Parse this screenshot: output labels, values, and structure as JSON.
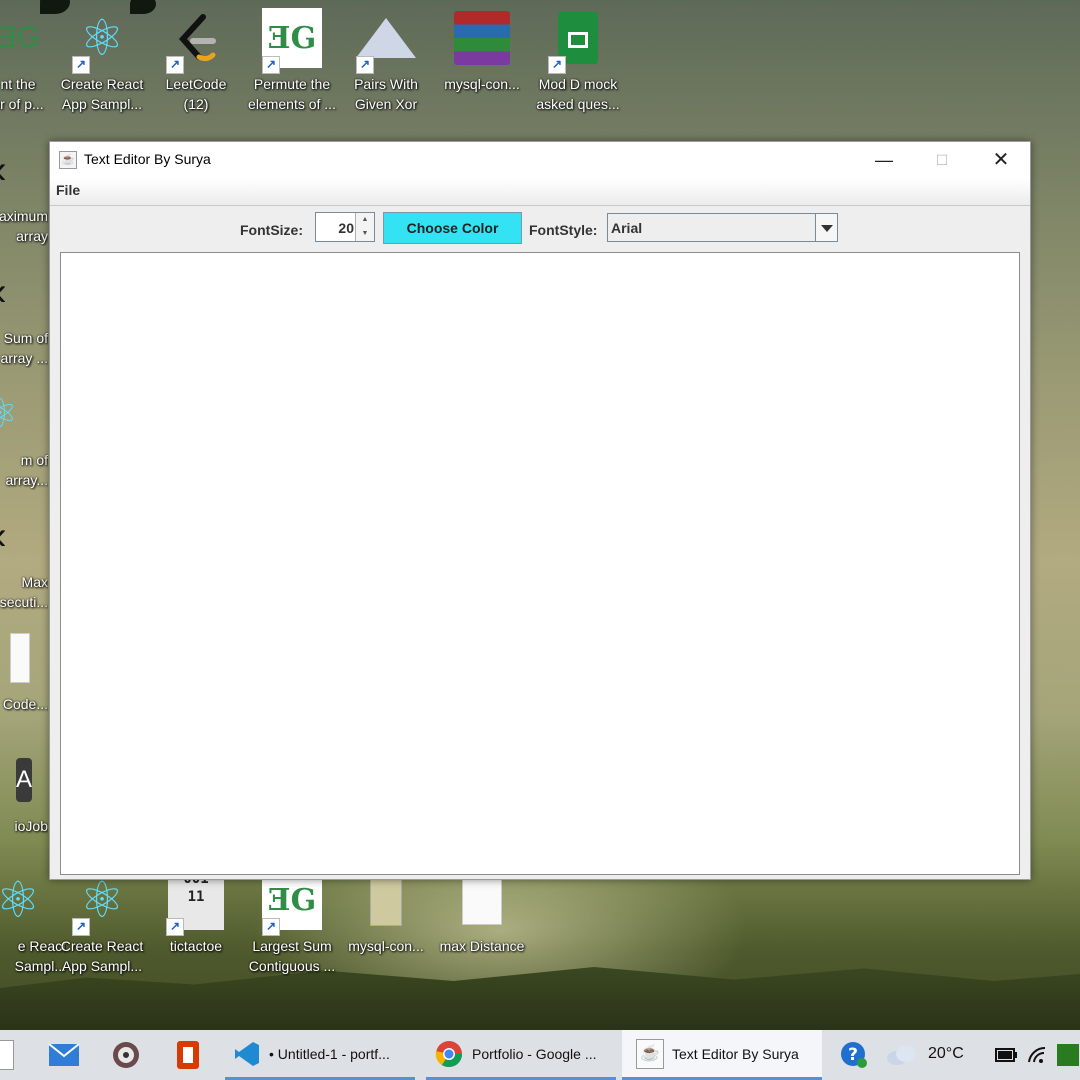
{
  "desktop": {
    "top_icons": [
      {
        "label1": "nt the",
        "label2": "er of p..."
      },
      {
        "label1": "Create React",
        "label2": "App Sampl..."
      },
      {
        "label1": "LeetCode",
        "label2": "(12)"
      },
      {
        "label1": "Permute the",
        "label2": "elements of ..."
      },
      {
        "label1": "Pairs With",
        "label2": "Given Xor"
      },
      {
        "label1": "mysql-con...",
        "label2": ""
      },
      {
        "label1": "Mod D mock",
        "label2": "asked ques..."
      }
    ],
    "left_icons": [
      {
        "label1": "aximum",
        "label2": "array"
      },
      {
        "label1": "Sum of",
        "label2": "array ..."
      },
      {
        "label1": "m of",
        "label2": "array..."
      },
      {
        "label1": "Max",
        "label2": "secuti..."
      },
      {
        "label1": "Code...",
        "label2": ""
      },
      {
        "label1": "ioJob",
        "label2": ""
      }
    ],
    "bottom_icons": [
      {
        "label1": "e React",
        "label2": "Sampl..."
      },
      {
        "label1": "Create React",
        "label2": "App Sampl..."
      },
      {
        "label1": "tictactoe",
        "label2": ""
      },
      {
        "label1": "Largest Sum",
        "label2": "Contiguous ..."
      },
      {
        "label1": "mysql-con...",
        "label2": ""
      },
      {
        "label1": "max Distance",
        "label2": ""
      }
    ],
    "gfg_glyph": "ƎG",
    "tictactoe_glyph": "001\n11"
  },
  "window": {
    "title": "Text Editor By Surya",
    "menu": {
      "file": "File"
    },
    "toolbar": {
      "font_size_label": "FontSize:",
      "font_size_value": "20",
      "choose_color_label": "Choose Color",
      "font_style_label": "FontStyle:",
      "font_style_value": "Arial"
    },
    "colors": {
      "choose_color_bg": "#33e3f3",
      "window_bg": "#eeeeee"
    }
  },
  "taskbar": {
    "tasks": [
      {
        "label": "• Untitled-1 - portf..."
      },
      {
        "label": "Portfolio - Google ..."
      },
      {
        "label": "Text Editor By Surya"
      }
    ],
    "temperature": "20°C"
  }
}
